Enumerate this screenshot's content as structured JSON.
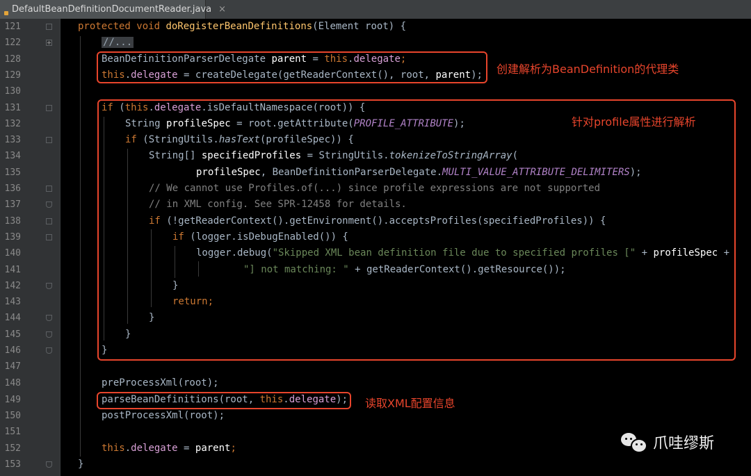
{
  "tab": {
    "title": "DefaultBeanDefinitionDocumentReader.java",
    "close": "×",
    "icon": "java-class-icon"
  },
  "code_lines": [
    {
      "num": "121",
      "fold": "open"
    },
    {
      "num": "122",
      "fold": "collapsed"
    },
    {
      "num": "128",
      "fold": ""
    },
    {
      "num": "129",
      "fold": ""
    },
    {
      "num": "130",
      "fold": ""
    },
    {
      "num": "131",
      "fold": "open"
    },
    {
      "num": "132",
      "fold": ""
    },
    {
      "num": "133",
      "fold": "open"
    },
    {
      "num": "134",
      "fold": ""
    },
    {
      "num": "135",
      "fold": ""
    },
    {
      "num": "136",
      "fold": "open"
    },
    {
      "num": "137",
      "fold": "close"
    },
    {
      "num": "138",
      "fold": "open"
    },
    {
      "num": "139",
      "fold": "open"
    },
    {
      "num": "140",
      "fold": ""
    },
    {
      "num": "141",
      "fold": ""
    },
    {
      "num": "142",
      "fold": "close"
    },
    {
      "num": "143",
      "fold": ""
    },
    {
      "num": "144",
      "fold": "close"
    },
    {
      "num": "145",
      "fold": "close"
    },
    {
      "num": "146",
      "fold": "close"
    },
    {
      "num": "147",
      "fold": ""
    },
    {
      "num": "148",
      "fold": ""
    },
    {
      "num": "149",
      "fold": ""
    },
    {
      "num": "150",
      "fold": ""
    },
    {
      "num": "151",
      "fold": ""
    },
    {
      "num": "152",
      "fold": ""
    },
    {
      "num": "153",
      "fold": "close"
    }
  ],
  "code": {
    "l121": {
      "protected": "protected",
      "void": "void",
      "method": "doRegisterBeanDefinitions",
      "open": "(",
      "type": "Element",
      "param": " root) {"
    },
    "l122": {
      "folded": "//..."
    },
    "l128": {
      "type": "BeanDefinitionParserDelegate",
      "var": " parent",
      "eq": " = ",
      "this": "this",
      "dot": ".",
      "field": "delegate",
      "semi": ";"
    },
    "l129": {
      "this": "this",
      "dot": ".",
      "field": "delegate",
      "rest1": " = ",
      "call": "createDelegate",
      "rest2": "(",
      "call2": "getReaderContext",
      "rest3": "(), root, ",
      "var": "parent",
      "rest4": ");"
    },
    "l131": {
      "if": "if",
      "p1": " (",
      "this": "this",
      "dot": ".",
      "field": "delegate",
      "rest": ".isDefaultNamespace(root)) {"
    },
    "l132": {
      "type": "String",
      "var": " profileSpec",
      "rest1": " = root.getAttribute(",
      "const": "PROFILE_ATTRIBUTE",
      "rest2": ");"
    },
    "l133": {
      "if": "if",
      "rest1": " (StringUtils.",
      "static": "hasText",
      "rest2": "(profileSpec)) {"
    },
    "l134": {
      "type": "String[]",
      "var": " specifiedProfiles",
      "rest1": " = StringUtils.",
      "static": "tokenizeToStringArray",
      "rest2": "("
    },
    "l135": {
      "var": "profileSpec",
      "rest1": ", BeanDefinitionParserDelegate.",
      "const": "MULTI_VALUE_ATTRIBUTE_DELIMITERS",
      "rest2": ");"
    },
    "l136": {
      "comment": "// We cannot use Profiles.of(...) since profile expressions are not supported"
    },
    "l137": {
      "comment": "// in XML config. See SPR-12458 for details."
    },
    "l138": {
      "if": "if",
      "rest": " (!getReaderContext().getEnvironment().acceptsProfiles(specifiedProfiles)) {"
    },
    "l139": {
      "if": "if",
      "rest": " (logger.isDebugEnabled()) {"
    },
    "l140": {
      "pre": "logger.debug(",
      "str": "\"Skipped XML bean definition file due to specified profiles [\"",
      "plus": " + ",
      "var": "profileSpec",
      "tail": " +"
    },
    "l141": {
      "str": "\"] not matching: \"",
      "rest": " + getReaderContext().getResource());"
    },
    "l142": {
      "brace": "}"
    },
    "l143": {
      "ret": "return",
      "semi": ";"
    },
    "l144": {
      "brace": "}"
    },
    "l145": {
      "brace": "}"
    },
    "l146": {
      "brace": "}"
    },
    "l148": {
      "rest": "preProcessXml(root);"
    },
    "l149": {
      "rest1": "parseBeanDefinitions(root, ",
      "this": "this",
      "dot": ".",
      "field": "delegate",
      "rest2": ");"
    },
    "l150": {
      "rest": "postProcessXml(root);"
    },
    "l152": {
      "this": "this",
      "dot": ".",
      "field": "delegate",
      "rest1": " = ",
      "var": "parent",
      "semi": ";"
    },
    "l153": {
      "brace": "}"
    }
  },
  "annotations": {
    "delegate": "创建解析为BeanDefinition的代理类",
    "profile": "针对profile属性进行解析",
    "parse": "读取XML配置信息"
  },
  "watermark": {
    "text": "爪哇缪斯",
    "icon": "wechat-icon"
  },
  "colors": {
    "annotation": "#e8452c",
    "keyword": "#cc7832",
    "method_decl": "#ffc66d",
    "field": "#d8a0d6",
    "string": "#6a8759",
    "comment": "#808080"
  }
}
